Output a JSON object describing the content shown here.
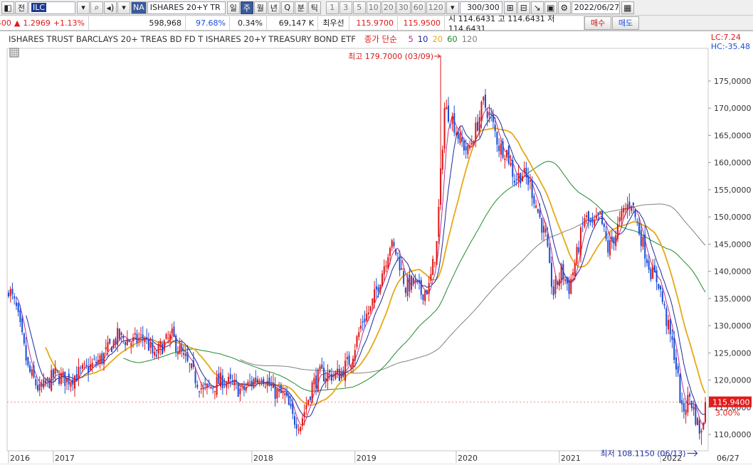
{
  "toolbar": {
    "jeon_label": "전",
    "code": "ILC",
    "market_badge": "NA",
    "symbol_name": "ISHARES 20+Y TR",
    "periods": [
      "일",
      "주",
      "월",
      "년",
      "Q",
      "분",
      "틱"
    ],
    "selected_period": "주",
    "intervals": [
      "1",
      "3",
      "5",
      "10",
      "20",
      "30",
      "60",
      "120"
    ],
    "count": "300/300",
    "date": "2022/06/27"
  },
  "quote": {
    "price": "115.9400",
    "change_arrow": "▲",
    "change": "1.2969",
    "change_pct": "+1.13%",
    "volume": "598,968",
    "vol_ratio": "97.68%",
    "vol_pct": "0.34%",
    "amount": "69,147 K",
    "best_label": "최우선",
    "ask": "115.9700",
    "bid": "115.9500",
    "ohlc": "시 114.6431 고 114.6431 저 114.6431",
    "buy_label": "매수",
    "sell_label": "매도"
  },
  "chart_header": {
    "title": "ISHARES TRUST BARCLAYS 20+ TREAS BD FD T  ISHARES 20+Y TREASURY BOND ETF",
    "ma_prefix": "종가 단순",
    "ma_periods": [
      "5",
      "10",
      "20",
      "60",
      "120"
    ],
    "lc": "LC:7.24",
    "hc": "HC:-35.48"
  },
  "colors": {
    "up": "#e01818",
    "down": "#1c4ed8",
    "ma5": "#c0308a",
    "ma10": "#1a2a9c",
    "ma20": "#e6a817",
    "ma60": "#1f8a2e",
    "ma120": "#808080",
    "price_tag": "#e21b1b"
  },
  "chart_data": {
    "type": "candlestick-weekly",
    "y_ticks": [
      "110,0000",
      "115,0000",
      "120,0000",
      "125,0000",
      "130,0000",
      "135,0000",
      "140,0000",
      "145,0000",
      "150,0000",
      "155,0000",
      "160,0000",
      "165,0000",
      "170,0000",
      "175,0000"
    ],
    "ylim": [
      107,
      181
    ],
    "x_labels": [
      "2016",
      "2017",
      "2018",
      "2019",
      "2020",
      "2021",
      "2022",
      "06/27"
    ],
    "last_price_tag": "115.9400",
    "last_pct_tag": "3.00%",
    "max_label": "최고 179.7000 (03/09)",
    "max_value": 179.7,
    "min_label": "최저 108.1150 (06/13)",
    "min_value": 108.115,
    "close_path": [
      [
        0,
        137
      ],
      [
        4,
        133
      ],
      [
        10,
        122
      ],
      [
        16,
        118
      ],
      [
        24,
        121
      ],
      [
        30,
        120
      ],
      [
        40,
        122
      ],
      [
        48,
        124
      ],
      [
        56,
        128
      ],
      [
        64,
        127
      ],
      [
        70,
        128
      ],
      [
        75,
        124
      ],
      [
        78,
        126
      ],
      [
        84,
        128
      ],
      [
        90,
        124
      ],
      [
        95,
        121
      ],
      [
        100,
        118
      ],
      [
        110,
        120
      ],
      [
        120,
        118
      ],
      [
        126,
        120
      ],
      [
        130,
        121
      ],
      [
        136,
        118
      ],
      [
        142,
        117
      ],
      [
        146,
        113
      ],
      [
        150,
        112
      ],
      [
        156,
        119
      ],
      [
        160,
        121
      ],
      [
        170,
        121
      ],
      [
        176,
        124
      ],
      [
        182,
        131
      ],
      [
        186,
        133
      ],
      [
        192,
        140
      ],
      [
        196,
        145
      ],
      [
        200,
        143
      ],
      [
        204,
        137
      ],
      [
        208,
        138
      ],
      [
        212,
        136
      ],
      [
        216,
        137
      ],
      [
        220,
        145
      ],
      [
        224,
        170
      ],
      [
        228,
        168
      ],
      [
        232,
        164
      ],
      [
        236,
        162
      ],
      [
        240,
        166
      ],
      [
        244,
        171
      ],
      [
        248,
        168
      ],
      [
        252,
        163
      ],
      [
        256,
        162
      ],
      [
        260,
        157
      ],
      [
        264,
        158
      ],
      [
        268,
        156
      ],
      [
        272,
        151
      ],
      [
        276,
        146
      ],
      [
        278,
        140
      ],
      [
        280,
        136
      ],
      [
        284,
        140
      ],
      [
        288,
        137
      ],
      [
        292,
        143
      ],
      [
        296,
        150
      ],
      [
        300,
        148
      ],
      [
        304,
        150
      ],
      [
        308,
        144
      ],
      [
        312,
        147
      ],
      [
        316,
        151
      ],
      [
        320,
        153
      ],
      [
        322,
        150
      ],
      [
        326,
        145
      ],
      [
        330,
        140
      ],
      [
        334,
        138
      ],
      [
        338,
        131
      ],
      [
        342,
        125
      ],
      [
        344,
        120
      ],
      [
        346,
        114
      ],
      [
        350,
        117
      ],
      [
        354,
        112
      ],
      [
        356,
        110
      ],
      [
        358,
        115.94
      ]
    ],
    "ma_periods": [
      5,
      10,
      20,
      60,
      120
    ]
  }
}
